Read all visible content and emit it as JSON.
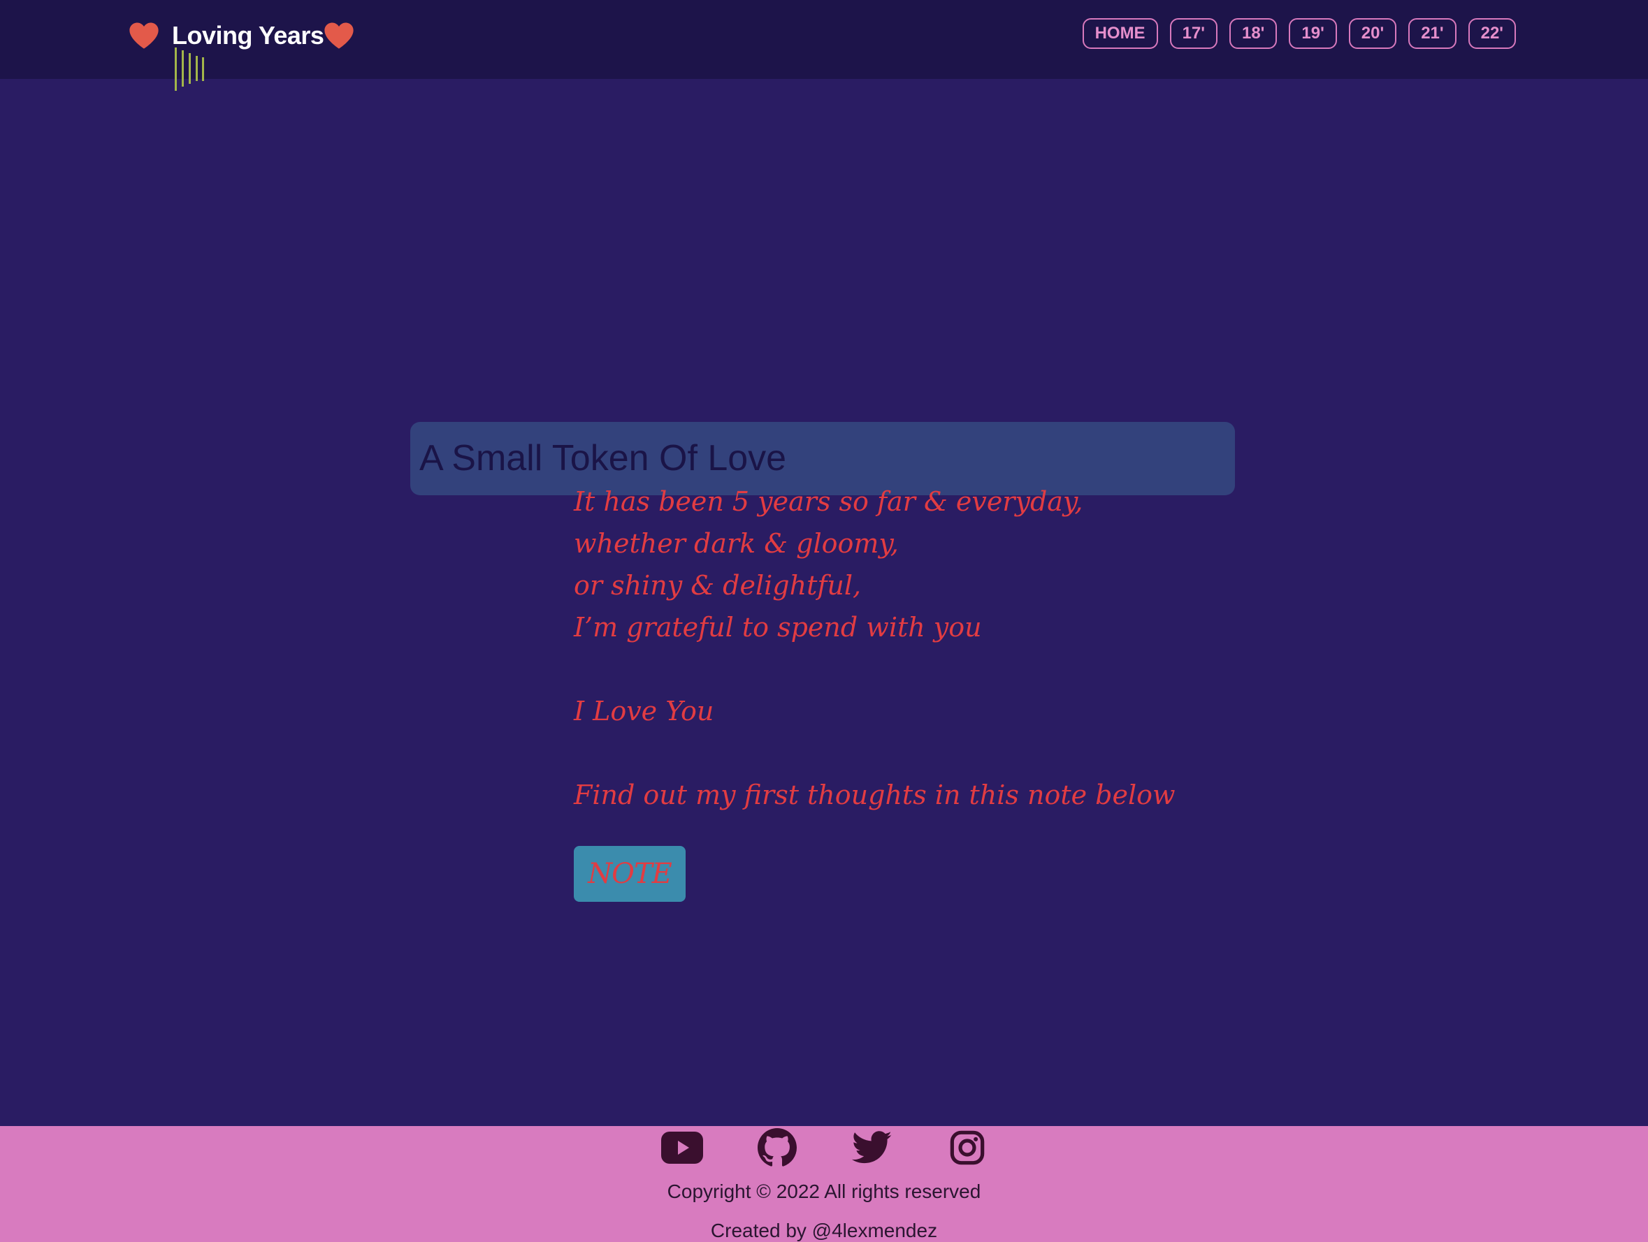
{
  "header": {
    "brand_title": "Loving Years",
    "brand_icons": [
      "heart-icon",
      "music-bars-icon"
    ],
    "nav": [
      {
        "label": "HOME"
      },
      {
        "label": "17'"
      },
      {
        "label": "18'"
      },
      {
        "label": "19'"
      },
      {
        "label": "20'"
      },
      {
        "label": "21'"
      },
      {
        "label": "22'"
      }
    ]
  },
  "main": {
    "title": "A Small Token Of Love",
    "poem": [
      "It has been 5 years so far & everyday,",
      "whether dark & gloomy,",
      "or shiny & delightful,",
      "I’m grateful to spend with you",
      "I Love You",
      "Find out my first thoughts in this note below"
    ],
    "note_button": "NOTE"
  },
  "footer": {
    "socials": [
      "youtube-icon",
      "github-icon",
      "twitter-icon",
      "instagram-icon"
    ],
    "copyright": "Copyright © 2022 All rights reserved",
    "created_by": "Created by @4lexmendez"
  },
  "colors": {
    "background": "#2a1c63",
    "header": "#1d144a",
    "title_bar": "#33427c",
    "poem_text": "#e23c42",
    "note_button": "#3b8cad",
    "nav_accent": "#d879bd",
    "footer": "#d87bbf",
    "heart": "#e35a4a",
    "music_bars": "#a3b64a"
  }
}
